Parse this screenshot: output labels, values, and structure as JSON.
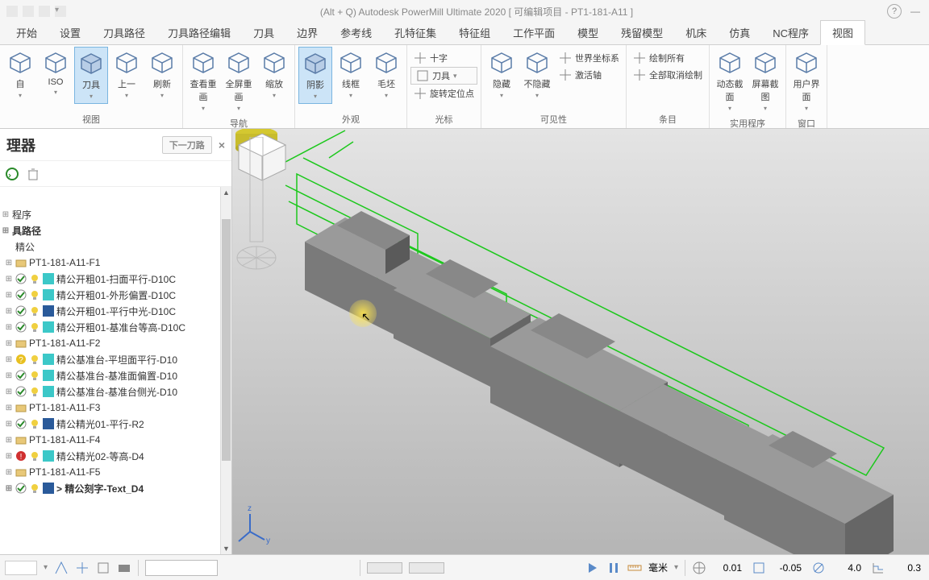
{
  "titlebar": {
    "text": "(Alt + Q) Autodesk PowerMill Ultimate 2020   [ 可编辑项目 - PT1-181-A11 ]"
  },
  "tabs": [
    "开始",
    "设置",
    "刀具路径",
    "刀具路径编辑",
    "刀具",
    "边界",
    "参考线",
    "孔特征集",
    "特征组",
    "工作平面",
    "模型",
    "残留模型",
    "机床",
    "仿真",
    "NC程序",
    "视图"
  ],
  "active_tab_index": 15,
  "ribbon": {
    "groups": [
      {
        "label": "视图",
        "buttons": [
          {
            "label": "自",
            "type": "lg"
          },
          {
            "label": "ISO",
            "type": "lg"
          },
          {
            "label": "刀具",
            "type": "lg",
            "active": true
          },
          {
            "label": "上一",
            "type": "lg"
          },
          {
            "label": "刷新",
            "type": "lg"
          }
        ]
      },
      {
        "label": "导航",
        "buttons": [
          {
            "label": "查看重画",
            "type": "lg"
          },
          {
            "label": "全屏重画",
            "type": "lg-nolabel"
          },
          {
            "label": "缩放",
            "type": "lg"
          }
        ]
      },
      {
        "label": "外观",
        "buttons": [
          {
            "label": "阴影",
            "type": "lg",
            "active": true
          },
          {
            "label": "线框",
            "type": "lg"
          },
          {
            "label": "毛坯",
            "type": "lg"
          }
        ]
      },
      {
        "label": "光标",
        "buttons": [
          {
            "label": "十字",
            "type": "sm"
          },
          {
            "label": "刀具",
            "type": "sm-boxed"
          },
          {
            "label": "旋转定位点",
            "type": "sm"
          }
        ]
      },
      {
        "label": "可见性",
        "buttons": [
          {
            "label": "隐藏",
            "type": "lg"
          },
          {
            "label": "不隐藏",
            "type": "lg"
          },
          {
            "label": "世界坐标系",
            "type": "sm"
          },
          {
            "label": "激活轴",
            "type": "sm"
          }
        ]
      },
      {
        "label": "条目",
        "buttons": [
          {
            "label": "绘制所有",
            "type": "sm"
          },
          {
            "label": "全部取消绘制",
            "type": "sm"
          }
        ]
      },
      {
        "label": "实用程序",
        "buttons": [
          {
            "label": "动态截面",
            "type": "lg"
          },
          {
            "label": "屏幕截图",
            "type": "lg"
          }
        ]
      },
      {
        "label": "窗口",
        "buttons": [
          {
            "label": "用户界面",
            "type": "lg"
          }
        ]
      }
    ]
  },
  "sidepanel": {
    "title": "理器",
    "pill": "下一刀路",
    "tree": [
      {
        "level": 1,
        "label": "",
        "kind": "stub"
      },
      {
        "level": 1,
        "label": "程序",
        "kind": "folder"
      },
      {
        "level": 1,
        "label": "具路径",
        "kind": "folder",
        "bold": true
      },
      {
        "level": 2,
        "label": "精公",
        "kind": "plain"
      },
      {
        "level": 2,
        "label": "PT1-181-A11-F1",
        "kind": "group"
      },
      {
        "level": 3,
        "label": "精公开粗01-扫面平行-D10C",
        "kind": "path",
        "chk": true,
        "bulb": "on",
        "color": "#3cc8c8"
      },
      {
        "level": 3,
        "label": "精公开粗01-外形偏置-D10C",
        "kind": "path",
        "chk": true,
        "bulb": "on",
        "color": "#3cc8c8"
      },
      {
        "level": 3,
        "label": "精公开粗01-平行中光-D10C",
        "kind": "path",
        "chk": true,
        "bulb": "on",
        "color": "#2a5a9a"
      },
      {
        "level": 3,
        "label": "精公开粗01-基准台等高-D10C",
        "kind": "path",
        "chk": true,
        "bulb": "on",
        "color": "#3cc8c8"
      },
      {
        "level": 2,
        "label": "PT1-181-A11-F2",
        "kind": "group"
      },
      {
        "level": 3,
        "label": "精公基准台-平坦面平行-D10",
        "kind": "path",
        "chk": false,
        "bulb": "warn",
        "color": "#3cc8c8"
      },
      {
        "level": 3,
        "label": "精公基准台-基准面偏置-D10",
        "kind": "path",
        "chk": true,
        "bulb": "on",
        "color": "#3cc8c8"
      },
      {
        "level": 3,
        "label": "精公基准台-基准台侧光-D10",
        "kind": "path",
        "chk": true,
        "bulb": "on",
        "color": "#3cc8c8"
      },
      {
        "level": 2,
        "label": "PT1-181-A11-F3",
        "kind": "group"
      },
      {
        "level": 3,
        "label": "精公精光01-平行-R2",
        "kind": "path",
        "chk": true,
        "bulb": "on",
        "color": "#2a5a9a"
      },
      {
        "level": 2,
        "label": "PT1-181-A11-F4",
        "kind": "group"
      },
      {
        "level": 3,
        "label": "精公精光02-等高-D4",
        "kind": "path",
        "chk": false,
        "bulb": "err",
        "color": "#3cc8c8"
      },
      {
        "level": 2,
        "label": "PT1-181-A11-F5",
        "kind": "group"
      },
      {
        "level": 3,
        "label": "> 精公刻字-Text_D4",
        "kind": "path",
        "chk": true,
        "bulb": "on",
        "color": "#2a5a9a",
        "bold": true
      }
    ]
  },
  "status": {
    "unit": "毫米",
    "tol": "0.01",
    "val1": "-0.05",
    "val2": "4.0",
    "val3": "0.3"
  }
}
